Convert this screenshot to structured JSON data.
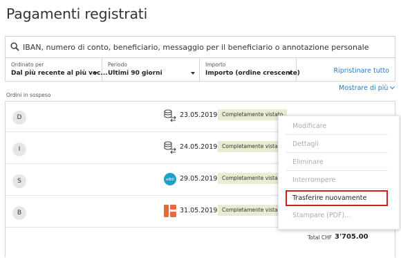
{
  "page": {
    "title": "Pagamenti registrati"
  },
  "search": {
    "placeholder": "IBAN, numero di conto, beneficiario, messaggio per il beneficiario o annotazione personale"
  },
  "filters": [
    {
      "label": "Ordinato per",
      "value": "Dal più recente al più vec..."
    },
    {
      "label": "Periodo",
      "value": "Ultimi 90 giorni"
    },
    {
      "label": "Importo",
      "value": "Importo (ordine crescente)"
    }
  ],
  "reset_label": "Ripristinare tutto",
  "show_more_label": "Mostrare di più",
  "section_label": "Ordini in sospeso",
  "orders": [
    {
      "initial": "D",
      "icon": "transfer-icon",
      "date": "23.05.2019",
      "status": "Completamente vistato"
    },
    {
      "initial": "I",
      "icon": "transfer-icon",
      "date": "24.05.2019",
      "status": "Completamente vistato"
    },
    {
      "initial": "S",
      "icon": "ebill-icon",
      "icon_text": "eBill",
      "date": "29.05.2019",
      "status": "Completamente vistato"
    },
    {
      "initial": "B",
      "icon": "grid-icon",
      "date": "31.05.2019",
      "status": "Completamente vistato"
    }
  ],
  "total": {
    "label": "Total CHF",
    "value": "3'705.00"
  },
  "context_menu": {
    "items": [
      "Modificare",
      "Dettagli",
      "Eliminare",
      "Interrompere",
      "Trasferire nuovamente",
      "Stampare (PDF)..."
    ],
    "highlighted_index": 4
  },
  "colors": {
    "accent": "#2a7ab8",
    "badge": "#e8ecd1",
    "highlight": "#d21c1c",
    "ebill": "#1f9fc9",
    "grid_icon": "#e86a3a"
  }
}
